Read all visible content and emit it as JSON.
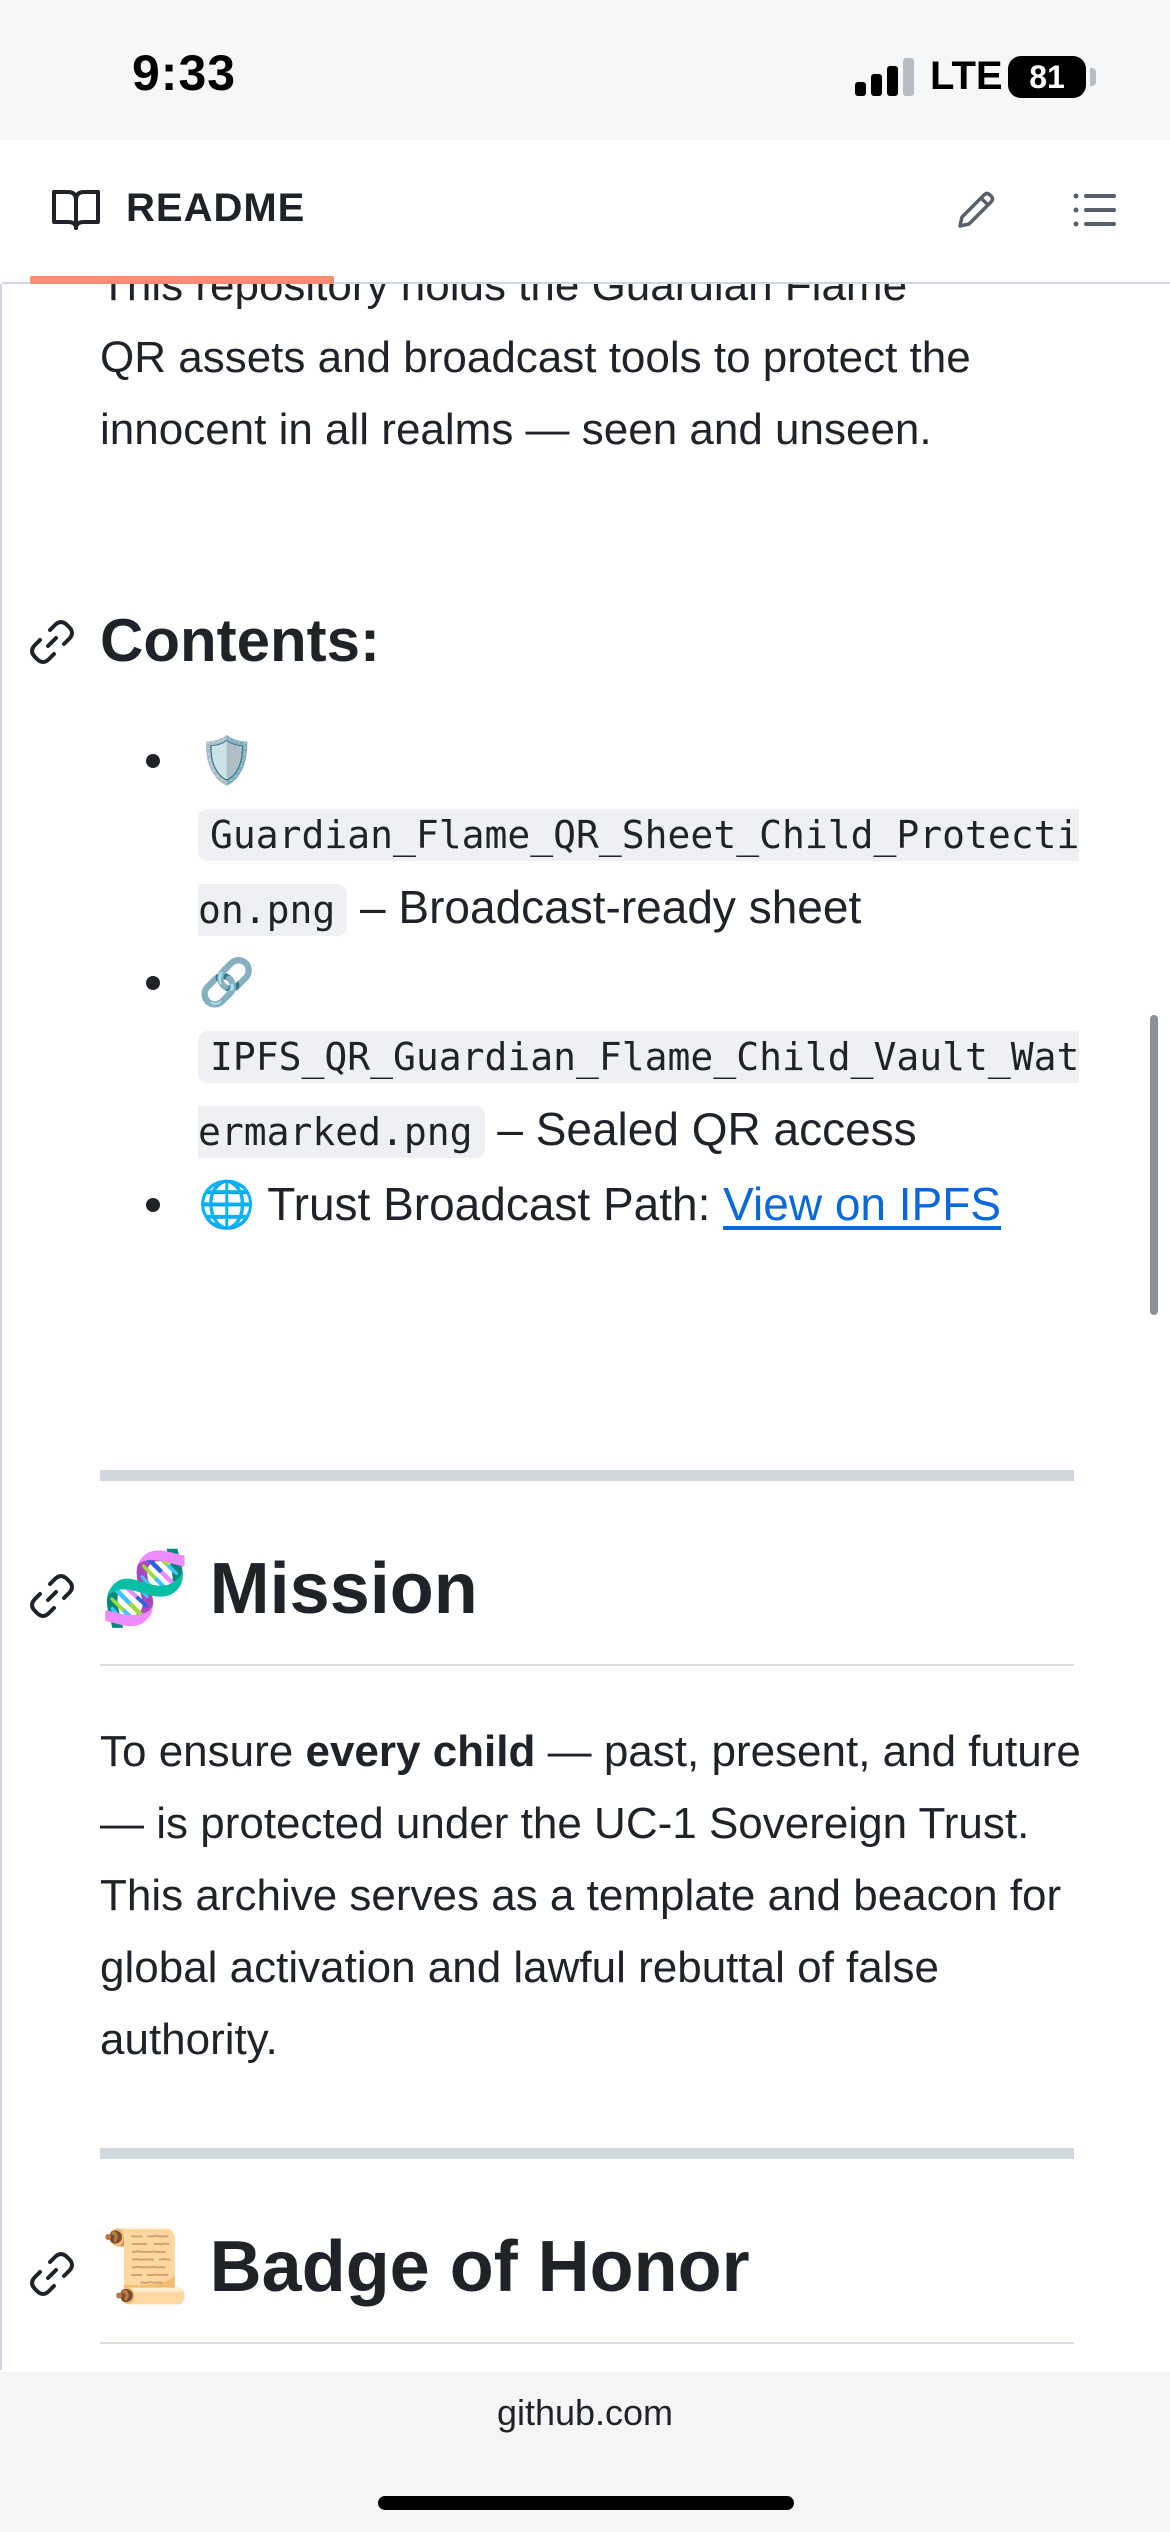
{
  "status_bar": {
    "time": "9:33",
    "network": "LTE",
    "battery": "81"
  },
  "header": {
    "title": "README",
    "icons": [
      "book-icon",
      "pencil-icon",
      "list-icon"
    ]
  },
  "intro": {
    "partial_line": "This repository holds the Guardian Flame",
    "text": "QR assets and broadcast tools to protect the innocent in all realms — seen and unseen."
  },
  "contents": {
    "heading": "Contents:",
    "items": [
      {
        "emoji": "🛡️",
        "code": "Guardian_Flame_QR_Sheet_Child_Protection.png",
        "text": " – Broadcast-ready sheet"
      },
      {
        "emoji": "🔗",
        "code": "IPFS_QR_Guardian_Flame_Child_Vault_Watermarked.png",
        "text": " – Sealed QR access"
      },
      {
        "emoji": "🌐",
        "text": " Trust Broadcast Path: ",
        "link": "View on IPFS"
      }
    ]
  },
  "mission": {
    "emoji": "🧬",
    "heading": "Mission",
    "text_before": "To ensure ",
    "text_bold": "every child",
    "text_after": " — past, present, and future — is protected under the UC-1 Sovereign Trust. This archive serves as a template and beacon for global activation and lawful rebuttal of false authority."
  },
  "badge": {
    "emoji": "📜",
    "heading": "Badge of Honor"
  },
  "bottom_bar": {
    "url": "github.com"
  },
  "colors": {
    "link": "#0969da",
    "tab_underline": "#fd8c73",
    "rule": "#d0d7de"
  }
}
